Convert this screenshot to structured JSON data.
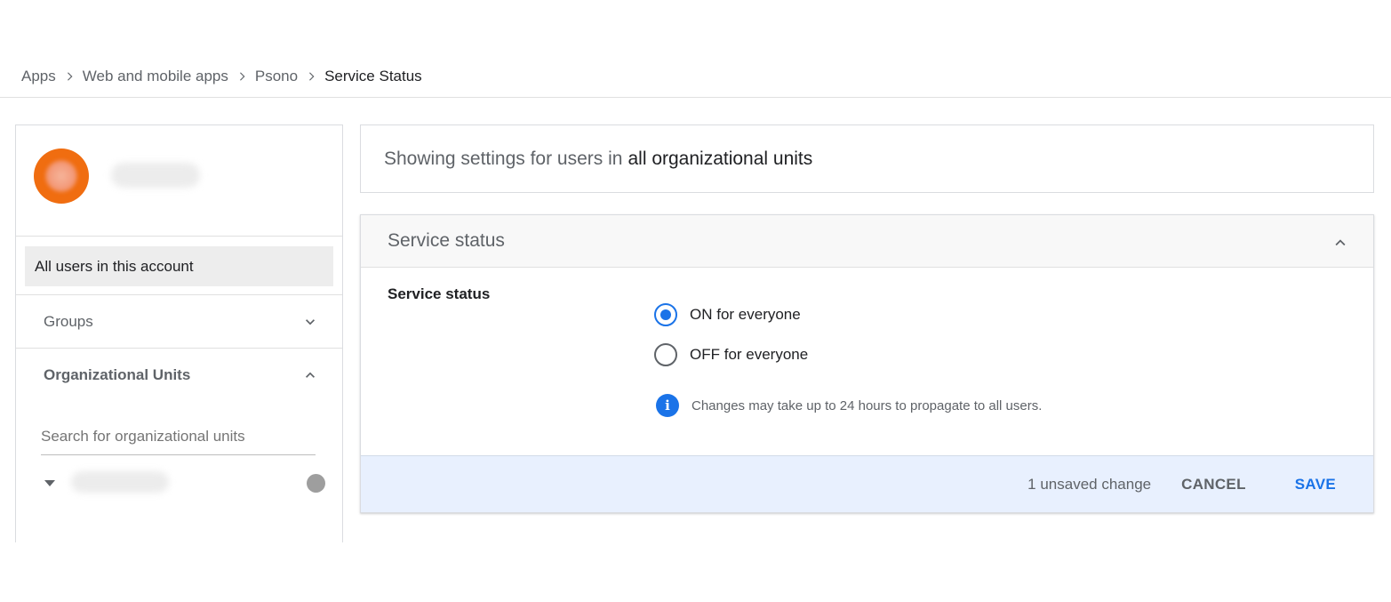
{
  "breadcrumb": {
    "items": [
      "Apps",
      "Web and mobile apps",
      "Psono",
      "Service Status"
    ]
  },
  "left_panel": {
    "all_users_label": "All users in this account",
    "groups_label": "Groups",
    "org_units_label": "Organizational Units",
    "search": {
      "placeholder": "Search for organizational units",
      "value": ""
    }
  },
  "scope": {
    "prefix": "Showing settings for users in",
    "target": "all organizational units"
  },
  "card": {
    "title": "Service status",
    "setting_label": "Service status",
    "options": [
      {
        "label": "ON for everyone",
        "checked": true
      },
      {
        "label": "OFF for everyone",
        "checked": false
      }
    ],
    "info_text": "Changes may take up to 24 hours to propagate to all users.",
    "info_icon_glyph": "i",
    "footer": {
      "unsaved": "1 unsaved change",
      "cancel_label": "CANCEL",
      "save_label": "SAVE"
    }
  },
  "colors": {
    "accent": "#1a73e8",
    "avatar": "#f06d10",
    "footer_bg": "#e8f0fe",
    "status_dot": "#9e9e9e"
  }
}
